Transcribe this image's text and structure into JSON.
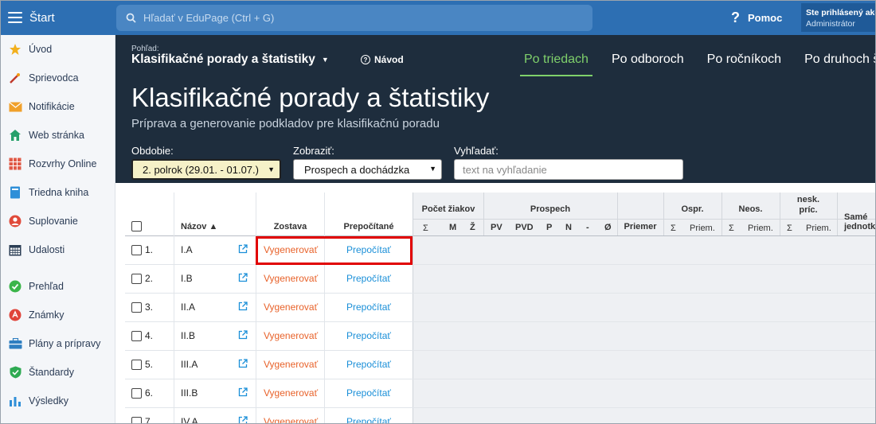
{
  "topbar": {
    "menu_label": "Štart",
    "search_placeholder": "Hľadať v EduPage (Ctrl + G)",
    "help_label": "Pomoc",
    "user_line1": "Ste prihlásený ako",
    "user_line2": "Administrátor"
  },
  "sidebar": {
    "items": [
      {
        "label": "Úvod",
        "icon": "star-icon"
      },
      {
        "label": "Sprievodca",
        "icon": "wand-icon"
      },
      {
        "label": "Notifikácie",
        "icon": "envelope-icon"
      },
      {
        "label": "Web stránka",
        "icon": "house-icon"
      },
      {
        "label": "Rozvrhy Online",
        "icon": "timetable-icon"
      },
      {
        "label": "Triedna kniha",
        "icon": "book-icon"
      },
      {
        "label": "Suplovanie",
        "icon": "person-icon"
      },
      {
        "label": "Udalosti",
        "icon": "calendar-icon"
      },
      {
        "label": "Prehľad",
        "icon": "check-circle-icon"
      },
      {
        "label": "Známky",
        "icon": "grade-icon"
      },
      {
        "label": "Plány a prípravy",
        "icon": "briefcase-icon"
      },
      {
        "label": "Štandardy",
        "icon": "shield-check-icon"
      },
      {
        "label": "Výsledky",
        "icon": "bar-chart-icon"
      }
    ]
  },
  "header": {
    "view_label": "Pohľad:",
    "view_value": "Klasifikačné porady a štatistiky",
    "guide_label": "Návod",
    "tabs": [
      "Po triedach",
      "Po odboroch",
      "Po ročníkoch",
      "Po druhoch š"
    ],
    "title": "Klasifikačné porady a štatistiky",
    "subtitle": "Príprava a generovanie podkladov pre klasifikačnú poradu",
    "filters": {
      "obdobie_label": "Obdobie:",
      "obdobie_value": "2. polrok (29.01. - 01.07.)",
      "zobrazit_label": "Zobraziť:",
      "zobrazit_value": "Prospech a dochádzka",
      "vyhladat_label": "Vyhľadať:",
      "vyhladat_placeholder": "text na vyhľadanie"
    }
  },
  "table": {
    "col_nazov": "Názov ▲",
    "col_zostava": "Zostava",
    "col_prepocitane": "Prepočítané",
    "grp_pocet": "Počet žiakov",
    "grp_prospech": "Prospech",
    "col_priemer": "Priemer",
    "grp_ospr": "Ospr.",
    "grp_neos": "Neos.",
    "grp_nesk_1": "nesk.",
    "grp_nesk_2": "príc.",
    "grp_same_1": "Samé",
    "grp_same_2": "jednotk",
    "sub": [
      "Σ",
      "M",
      "Ž",
      "PV",
      "PVD",
      "P",
      "N",
      "-",
      "Ø",
      "Σ",
      "Priem.",
      "Σ",
      "Priem.",
      "Σ",
      "Priem."
    ],
    "action_generate": "Vygenerovať",
    "action_recalc": "Prepočítať",
    "rows": [
      {
        "num": "1.",
        "name": "I.A"
      },
      {
        "num": "2.",
        "name": "I.B"
      },
      {
        "num": "3.",
        "name": "II.A"
      },
      {
        "num": "4.",
        "name": "II.B"
      },
      {
        "num": "5.",
        "name": "III.A"
      },
      {
        "num": "6.",
        "name": "III.B"
      },
      {
        "num": "7.",
        "name": "IV.A"
      }
    ]
  },
  "colors": {
    "topbar": "#2d6fb3",
    "header_bg": "#1e2d3d",
    "active_tab": "#7fd06b",
    "generate": "#e8622a",
    "recalc": "#1a8fd8",
    "highlight": "#e10000"
  }
}
